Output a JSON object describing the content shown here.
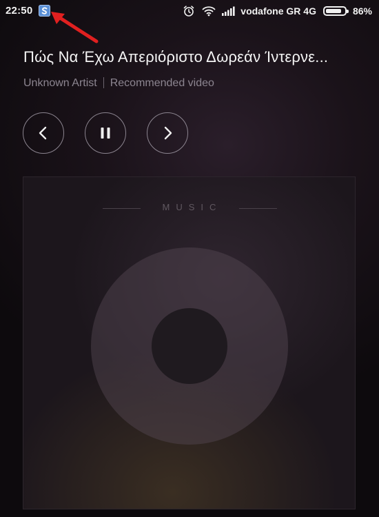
{
  "status_bar": {
    "time": "22:50",
    "notification_icon": "app-notification-icon",
    "carrier": "vodafone GR 4G",
    "battery_percent_label": "86%",
    "battery_level": 0.86,
    "icons": [
      "alarm-icon",
      "wifi-icon",
      "signal-icon",
      "battery-icon"
    ]
  },
  "annotation": {
    "arrow_color": "#e02020"
  },
  "track": {
    "title": "Πώς Να Έχω Απεριόριστο Δωρεάν Ίντερνε...",
    "artist": "Unknown Artist",
    "source": "Recommended video"
  },
  "controls": {
    "previous_icon": "chevron-left-icon",
    "pause_icon": "pause-icon",
    "next_icon": "chevron-right-icon"
  },
  "artwork": {
    "label": "MUSIC"
  },
  "colors": {
    "text_primary": "#f4f4f4",
    "text_secondary": "#8c8590",
    "notification_blue": "#5b8fd6"
  }
}
